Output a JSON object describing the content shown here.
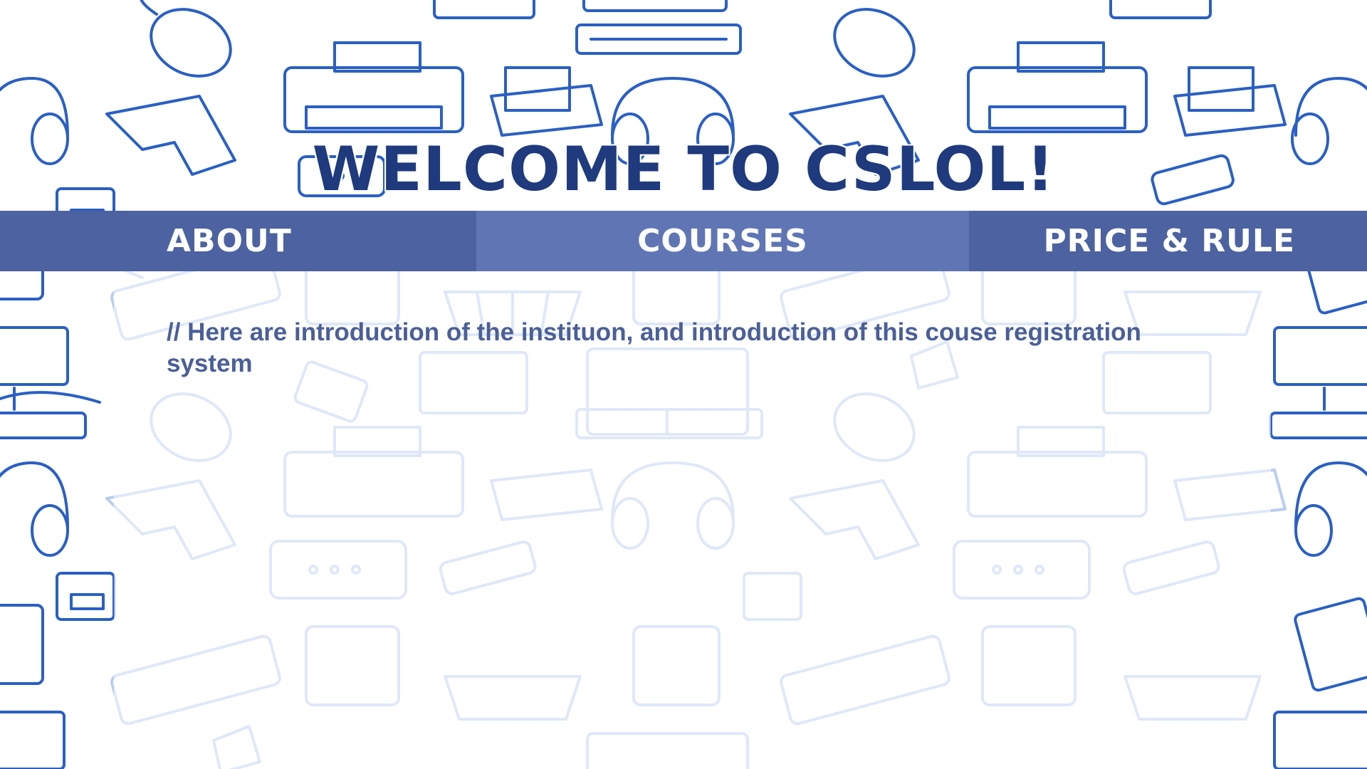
{
  "header": {
    "title": "WELCOME TO CSLOL!"
  },
  "nav": {
    "items": [
      {
        "label": "ABOUT"
      },
      {
        "label": "COURSES"
      },
      {
        "label": "PRICE & RULE"
      }
    ]
  },
  "main": {
    "intro_text": "// Here are introduction of the instituon, and introduction of this couse registration system"
  },
  "colors": {
    "title": "#1f3a7d",
    "nav_dark": "#4d62a0",
    "nav_light": "#6076b4",
    "intro_text": "#4b5f98",
    "pattern_strong": "#2a5fc4",
    "pattern_faded": "#b9cdf0"
  }
}
